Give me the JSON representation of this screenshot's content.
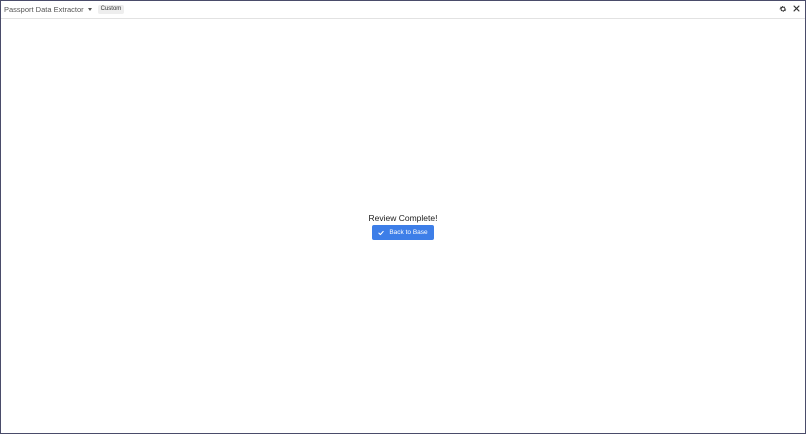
{
  "titlebar": {
    "app_name": "Passport Data Extractor",
    "mode_badge": "Custom",
    "icons": [
      "chevron-down-icon",
      "gear-icon",
      "close-icon"
    ]
  },
  "main": {
    "status_text": "Review Complete!",
    "back_button_label": "Back to Base",
    "back_button_icon": "check-icon"
  },
  "colors": {
    "accent": "#3d7ee8",
    "window_border": "#4a4c6a",
    "badge_bg": "#eeeeee"
  }
}
